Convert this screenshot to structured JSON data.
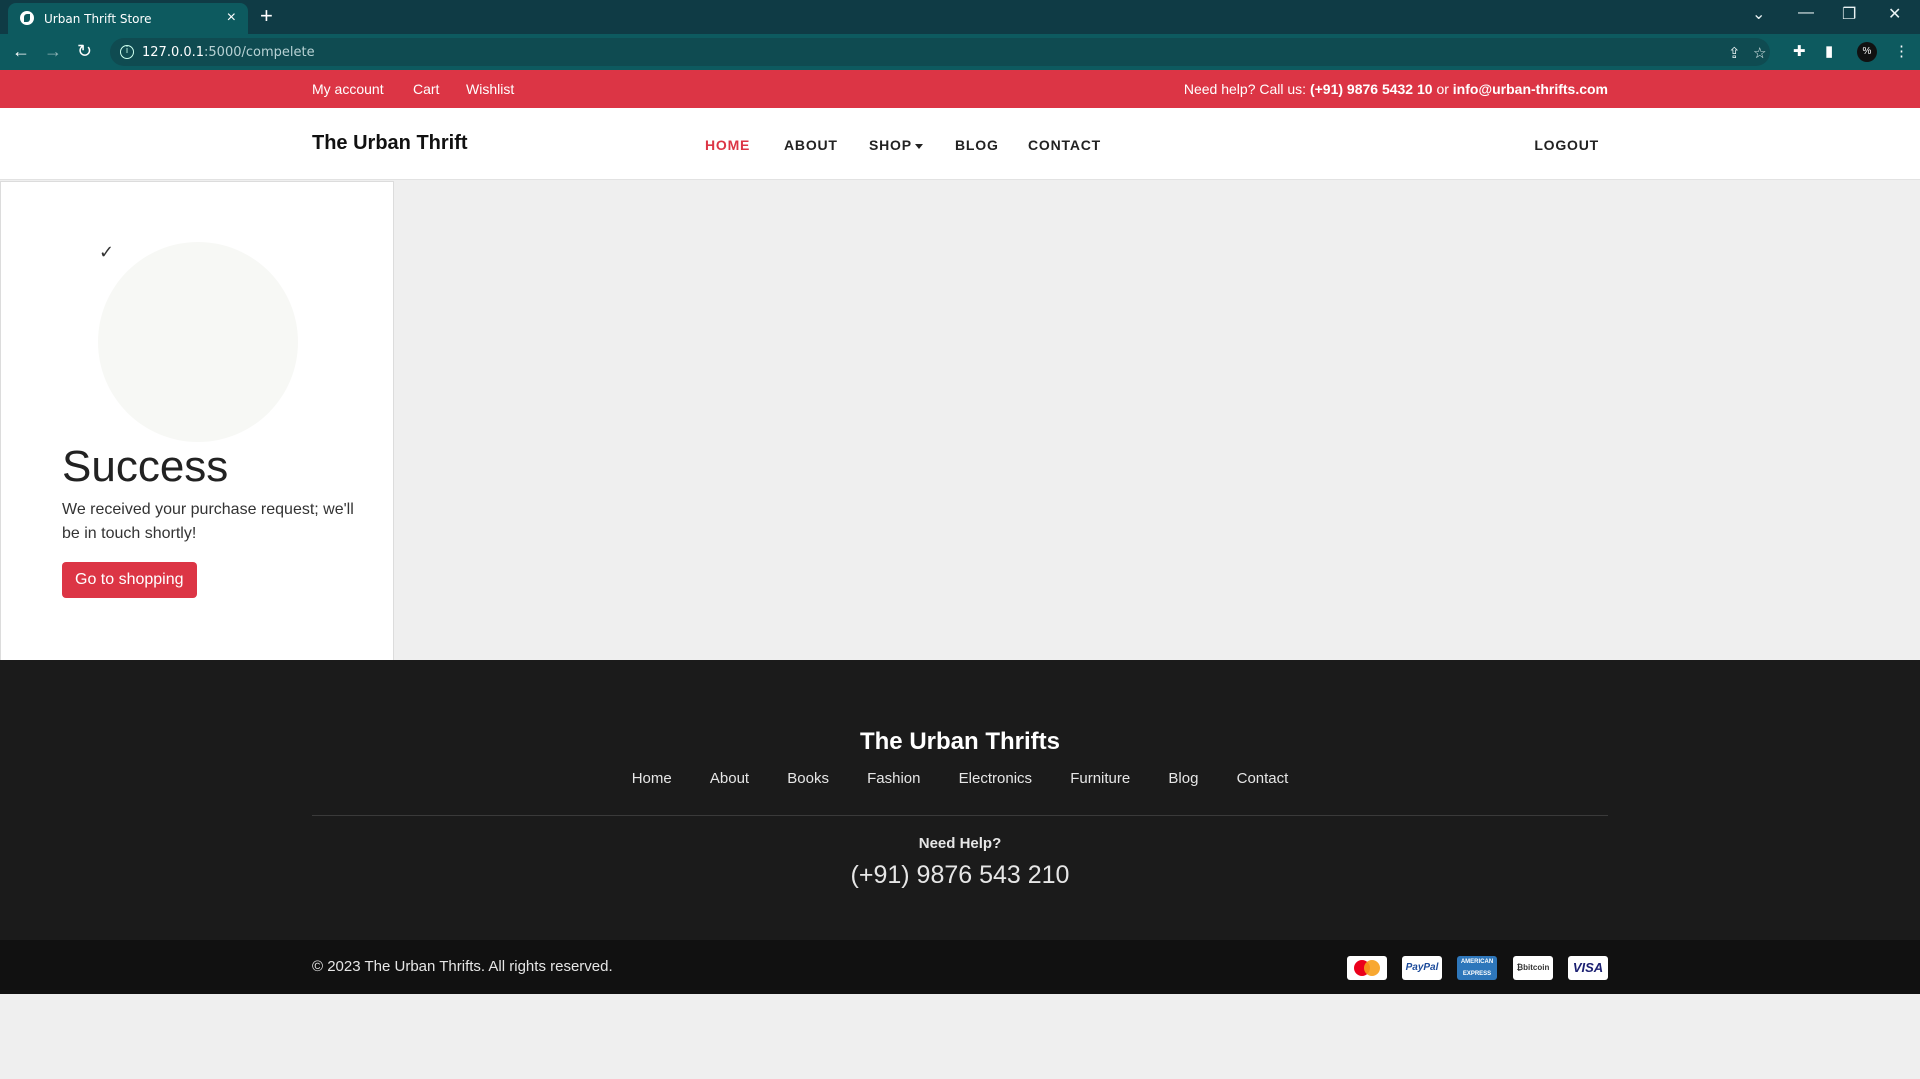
{
  "browser": {
    "tab_title": "Urban Thrift Store",
    "url_host": "127.0.0.1",
    "url_rest": ":5000/compelete"
  },
  "topbar": {
    "links": [
      "My account",
      "Cart",
      "Wishlist"
    ],
    "help_prefix": "Need help? Call us:",
    "help_phone": "(+91) 9876 5432 10",
    "help_or": "or",
    "help_email": "info@urban-thrifts.com"
  },
  "header": {
    "brand": "The Urban Thrift",
    "nav": [
      "HOME",
      "ABOUT",
      "SHOP",
      "BLOG",
      "CONTACT"
    ],
    "logout": "LOGOUT",
    "active_color": "#dc3545"
  },
  "success": {
    "check": "✓",
    "title": "Success",
    "message": "We received your purchase request; we'll be in touch shortly!",
    "button": "Go to shopping"
  },
  "footer": {
    "brand": "The Urban Thrifts",
    "links": [
      "Home",
      "About",
      "Books",
      "Fashion",
      "Electronics",
      "Furniture",
      "Blog",
      "Contact"
    ],
    "need_help": "Need Help?",
    "phone": "(+91) 9876 543 210",
    "copyright": "© 2023 The Urban Thrifts. All rights reserved.",
    "payment_icons": [
      "mastercard-icon",
      "paypal-icon",
      "american-express-icon",
      "bitcoin-icon",
      "visa-icon"
    ]
  },
  "colors": {
    "accent": "#dc3545",
    "browser_frame": "#0d5a5f",
    "footer_bg": "#1b1b1b"
  }
}
